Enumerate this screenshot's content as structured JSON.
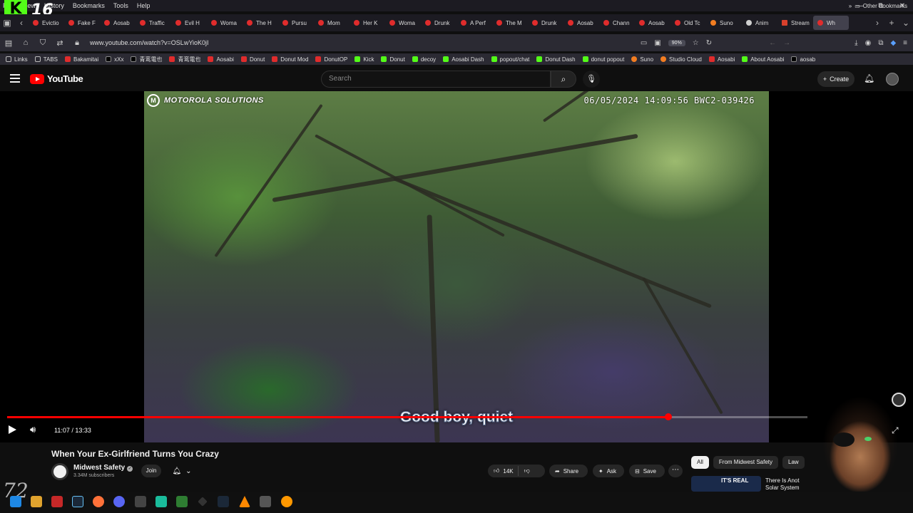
{
  "browser": {
    "menu": [
      "File",
      "View",
      "History",
      "Bookmarks",
      "Tools",
      "Help"
    ],
    "overlay_logo_letter": "K",
    "overlay_logo_number": "16",
    "window_controls": [
      "—",
      "⧉",
      "✕"
    ],
    "tabs": [
      {
        "label": "Evictio",
        "favicon": "youtube"
      },
      {
        "label": "Fake F",
        "favicon": "youtube"
      },
      {
        "label": "Aosab",
        "favicon": "youtube"
      },
      {
        "label": "Traffic",
        "favicon": "youtube"
      },
      {
        "label": "Evil H",
        "favicon": "youtube"
      },
      {
        "label": "Woma",
        "favicon": "youtube"
      },
      {
        "label": "The H",
        "favicon": "youtube"
      },
      {
        "label": "Pursu",
        "favicon": "youtube"
      },
      {
        "label": "Mom",
        "favicon": "youtube"
      },
      {
        "label": "Her K",
        "favicon": "youtube"
      },
      {
        "label": "Woma",
        "favicon": "youtube"
      },
      {
        "label": "Drunk",
        "favicon": "youtube"
      },
      {
        "label": "A Perf",
        "favicon": "youtube"
      },
      {
        "label": "The M",
        "favicon": "youtube"
      },
      {
        "label": "Drunk",
        "favicon": "youtube"
      },
      {
        "label": "Aosab",
        "favicon": "youtube"
      },
      {
        "label": "Chann",
        "favicon": "youtube"
      },
      {
        "label": "Aosab",
        "favicon": "youtube"
      },
      {
        "label": "Old Tc",
        "favicon": "youtube"
      },
      {
        "label": "Suno",
        "favicon": "suno"
      },
      {
        "label": "Anim",
        "favicon": "anime"
      },
      {
        "label": "Stream",
        "favicon": "stream"
      },
      {
        "label": "Wh",
        "favicon": "youtube",
        "active": true
      }
    ],
    "url": "www.youtube.com/watch?v=OSLwYioK0jI",
    "zoom": "90%",
    "bookmarks": [
      {
        "label": "Links",
        "favicon": "folder"
      },
      {
        "label": "TABS",
        "favicon": "folder"
      },
      {
        "label": "Bakamitai",
        "favicon": "youtube"
      },
      {
        "label": "xXx",
        "favicon": "x"
      },
      {
        "label": "青鸾電也",
        "favicon": "x"
      },
      {
        "label": "青鸾電也",
        "favicon": "youtube"
      },
      {
        "label": "Aosabi",
        "favicon": "youtube"
      },
      {
        "label": "Donut",
        "favicon": "youtube"
      },
      {
        "label": "Donut Mod",
        "favicon": "youtube"
      },
      {
        "label": "DonutOP",
        "favicon": "youtube"
      },
      {
        "label": "Kick",
        "favicon": "kick"
      },
      {
        "label": "Donut",
        "favicon": "kick"
      },
      {
        "label": "decoy",
        "favicon": "kick"
      },
      {
        "label": "Aosabi Dash",
        "favicon": "kick"
      },
      {
        "label": "popout/chat",
        "favicon": "kick"
      },
      {
        "label": "Donut Dash",
        "favicon": "kick"
      },
      {
        "label": "donut popout",
        "favicon": "kick"
      },
      {
        "label": "Suno",
        "favicon": "suno"
      },
      {
        "label": "Studio Cloud",
        "favicon": "suno"
      },
      {
        "label": "Aosabi",
        "favicon": "youtube"
      },
      {
        "label": "About Aosabi",
        "favicon": "kick"
      },
      {
        "label": "aosab",
        "favicon": "x"
      }
    ],
    "other_bookmarks": "Other Bookmarks"
  },
  "youtube": {
    "logo_text": "YouTube",
    "search_placeholder": "Search",
    "create_label": "Create"
  },
  "video": {
    "watermark": "MOTOROLA SOLUTIONS",
    "bodycam_stamp": "06/05/2024 14:09:56 BWC2-039426",
    "caption": "Good boy, quiet",
    "current_time": "11:07",
    "duration": "13:33",
    "time_readout": "11:07 / 13:33",
    "progress_fraction": 0.826,
    "progress_color": "#ff0000",
    "title": "When Your Ex-Girlfriend Turns You Crazy",
    "channel_name": "Midwest Safety",
    "subscribers": "3.34M subscribers",
    "join_label": "Join",
    "likes": "14K",
    "share_label": "Share",
    "ask_label": "Ask",
    "save_label": "Save"
  },
  "sidebar": {
    "chips": [
      {
        "label": "All",
        "active": true
      },
      {
        "label": "From Midwest Safety",
        "active": false
      },
      {
        "label": "Law",
        "active": false
      }
    ],
    "rec_thumb_text": "IT'S REAL",
    "rec_title": "There Is Anot Solar System"
  },
  "overlay": {
    "corner_text": "72"
  }
}
